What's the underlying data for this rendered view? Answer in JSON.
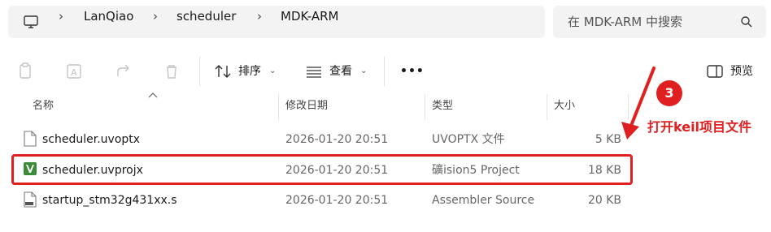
{
  "breadcrumb": {
    "items": [
      "LanQiao",
      "scheduler",
      "MDK-ARM"
    ],
    "separator": "›"
  },
  "search": {
    "placeholder": "在 MDK-ARM 中搜索"
  },
  "toolbar": {
    "sort_label": "排序",
    "view_label": "查看",
    "more_label": "•••",
    "preview_label": "预览"
  },
  "columns": {
    "name": "名称",
    "modified": "修改日期",
    "type": "类型",
    "size": "大小"
  },
  "files": [
    {
      "name": "scheduler.uvoptx",
      "modified": "2026-01-20 20:51",
      "type": "UVOPTX 文件",
      "size": "5 KB",
      "icon": "file-icon"
    },
    {
      "name": "scheduler.uvprojx",
      "modified": "2026-01-20 20:51",
      "type": "礦ision5 Project",
      "size": "18 KB",
      "icon": "keil-project-icon"
    },
    {
      "name": "startup_stm32g431xx.s",
      "modified": "2026-01-20 20:51",
      "type": "Assembler Source",
      "size": "20 KB",
      "icon": "assembler-file-icon"
    }
  ],
  "annotation": {
    "step": "3",
    "text": "打开keil项目文件",
    "color": "#e02020"
  }
}
